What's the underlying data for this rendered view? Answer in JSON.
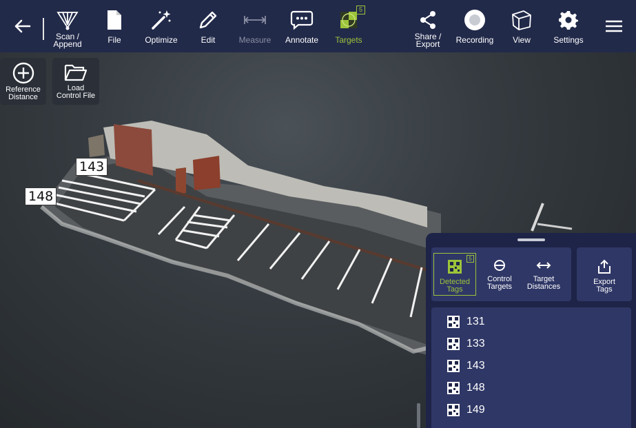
{
  "toolbar": {
    "items": [
      {
        "label": "Scan /\nAppend",
        "icon": "scan-append-icon"
      },
      {
        "label": "File",
        "icon": "file-icon"
      },
      {
        "label": "Optimize",
        "icon": "magic-wand-icon"
      },
      {
        "label": "Edit",
        "icon": "pencil-icon"
      },
      {
        "label": "Measure",
        "icon": "ruler-icon"
      },
      {
        "label": "Annotate",
        "icon": "chat-bubble-icon"
      },
      {
        "label": "Targets",
        "icon": "target-checker-icon",
        "badge": "5"
      },
      {
        "label": "Share /\nExport",
        "icon": "share-icon"
      },
      {
        "label": "Recording",
        "icon": "record-icon"
      },
      {
        "label": "View",
        "icon": "cube-icon"
      },
      {
        "label": "Settings",
        "icon": "gear-icon"
      }
    ]
  },
  "floating": {
    "reference_distance": "Reference\nDistance",
    "load_control_file": "Load\nControl File"
  },
  "scene_labels": {
    "tag_a": "143",
    "tag_b": "148"
  },
  "panel": {
    "tabs": [
      {
        "label": "Detected\nTags",
        "badge": "5"
      },
      {
        "label": "Control\nTargets"
      },
      {
        "label": "Target\nDistances"
      }
    ],
    "export": "Export\nTags",
    "tags": [
      "131",
      "133",
      "143",
      "148",
      "149"
    ]
  },
  "colors": {
    "toolbar_bg": "#222a4a",
    "accent": "#9cc43a",
    "panel_bg": "#1e2447"
  }
}
